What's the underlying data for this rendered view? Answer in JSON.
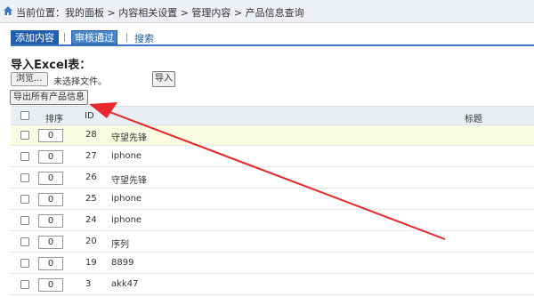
{
  "breadcrumb": {
    "text": "当前位置：我的面板 > 内容相关设置 > 管理内容 > 产品信息查询",
    "icon": "home-icon"
  },
  "tabs": {
    "add": "添加内容",
    "approve": "审核通过",
    "search": "搜索"
  },
  "import": {
    "title": "导入Excel表：",
    "browse_label": "浏览...",
    "file_status": "未选择文件。",
    "import_label": "导入"
  },
  "export_label": "导出所有产品信息",
  "table": {
    "headers": {
      "sort": "排序",
      "id": "ID",
      "title": "标题"
    },
    "rows": [
      {
        "sort": "0",
        "id": "28",
        "title": "守望先锋"
      },
      {
        "sort": "0",
        "id": "27",
        "title": "iphone"
      },
      {
        "sort": "0",
        "id": "26",
        "title": "守望先锋"
      },
      {
        "sort": "0",
        "id": "25",
        "title": "iphone"
      },
      {
        "sort": "0",
        "id": "24",
        "title": "iphone"
      },
      {
        "sort": "0",
        "id": "20",
        "title": "序列"
      },
      {
        "sort": "0",
        "id": "19",
        "title": "8899"
      },
      {
        "sort": "0",
        "id": "3",
        "title": "akk47"
      }
    ]
  },
  "colors": {
    "accent": "#3a78c3",
    "annotation_arrow": "#e8262b",
    "highlight_row": "#fbfde3"
  }
}
